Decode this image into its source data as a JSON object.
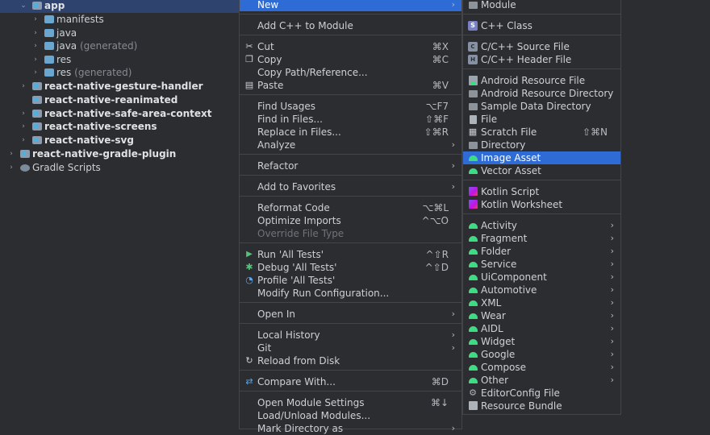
{
  "tree": {
    "items": [
      {
        "label": "app",
        "suffix": "",
        "bold": true,
        "chevron": "⌄",
        "icon": "module",
        "selected": true
      },
      {
        "label": "manifests",
        "suffix": "",
        "bold": false,
        "chevron": "›",
        "icon": "folder"
      },
      {
        "label": "java",
        "suffix": "",
        "bold": false,
        "chevron": "›",
        "icon": "folder"
      },
      {
        "label": "java",
        "suffix": "(generated)",
        "bold": false,
        "chevron": "›",
        "icon": "folder"
      },
      {
        "label": "res",
        "suffix": "",
        "bold": false,
        "chevron": "›",
        "icon": "folder"
      },
      {
        "label": "res",
        "suffix": "(generated)",
        "bold": false,
        "chevron": "›",
        "icon": "folder"
      },
      {
        "label": "react-native-gesture-handler",
        "suffix": "",
        "bold": true,
        "chevron": "›",
        "icon": "module"
      },
      {
        "label": "react-native-reanimated",
        "suffix": "",
        "bold": true,
        "chevron": "",
        "icon": "module"
      },
      {
        "label": "react-native-safe-area-context",
        "suffix": "",
        "bold": true,
        "chevron": "›",
        "icon": "module"
      },
      {
        "label": "react-native-screens",
        "suffix": "",
        "bold": true,
        "chevron": "›",
        "icon": "module"
      },
      {
        "label": "react-native-svg",
        "suffix": "",
        "bold": true,
        "chevron": "›",
        "icon": "module"
      },
      {
        "label": "react-native-gradle-plugin",
        "suffix": "",
        "bold": true,
        "chevron": "›",
        "icon": "module"
      },
      {
        "label": "Gradle Scripts",
        "suffix": "",
        "bold": false,
        "chevron": "›",
        "icon": "gradle"
      }
    ]
  },
  "context_menu": {
    "items": [
      {
        "label": "New",
        "highlighted": true,
        "submenu": true
      },
      {
        "label": "Add C++ to Module"
      },
      {
        "label": "Cut",
        "shortcut": "⌘X",
        "icon": "scissors-icon"
      },
      {
        "label": "Copy",
        "shortcut": "⌘C",
        "icon": "copy-icon"
      },
      {
        "label": "Copy Path/Reference..."
      },
      {
        "label": "Paste",
        "shortcut": "⌘V",
        "icon": "paste-icon"
      },
      {
        "label": "Find Usages",
        "shortcut": "⌥F7"
      },
      {
        "label": "Find in Files...",
        "shortcut": "⇧⌘F"
      },
      {
        "label": "Replace in Files...",
        "shortcut": "⇧⌘R"
      },
      {
        "label": "Analyze",
        "submenu": true
      },
      {
        "label": "Refactor",
        "submenu": true
      },
      {
        "label": "Add to Favorites",
        "submenu": true
      },
      {
        "label": "Reformat Code",
        "shortcut": "⌥⌘L"
      },
      {
        "label": "Optimize Imports",
        "shortcut": "^⌥O"
      },
      {
        "label": "Override File Type",
        "disabled": true
      },
      {
        "label": "Run 'All Tests'",
        "shortcut": "^⇧R",
        "icon": "run-icon"
      },
      {
        "label": "Debug 'All Tests'",
        "shortcut": "^⇧D",
        "icon": "debug-icon"
      },
      {
        "label": "Profile 'All Tests'",
        "icon": "profile-icon"
      },
      {
        "label": "Modify Run Configuration..."
      },
      {
        "label": "Open In",
        "submenu": true
      },
      {
        "label": "Local History",
        "submenu": true
      },
      {
        "label": "Git",
        "submenu": true
      },
      {
        "label": "Reload from Disk",
        "icon": "reload-icon"
      },
      {
        "label": "Compare With...",
        "shortcut": "⌘D",
        "icon": "compare-icon"
      },
      {
        "label": "Open Module Settings",
        "shortcut": "⌘↓"
      },
      {
        "label": "Load/Unload Modules..."
      },
      {
        "label": "Mark Directory as",
        "submenu": true
      }
    ]
  },
  "new_submenu": {
    "items": [
      {
        "label": "Module",
        "icon": "module-icon"
      },
      {
        "label": "C++ Class",
        "icon": "cpp-class-icon"
      },
      {
        "label": "C/C++ Source File",
        "icon": "cpp-source-icon"
      },
      {
        "label": "C/C++ Header File",
        "icon": "cpp-header-icon"
      },
      {
        "label": "Android Resource File",
        "icon": "android-resource-file-icon"
      },
      {
        "label": "Android Resource Directory",
        "icon": "folder-icon"
      },
      {
        "label": "Sample Data Directory",
        "icon": "folder-icon"
      },
      {
        "label": "File",
        "icon": "file-icon"
      },
      {
        "label": "Scratch File",
        "shortcut": "⇧⌘N",
        "icon": "scratch-file-icon"
      },
      {
        "label": "Directory",
        "icon": "folder-icon"
      },
      {
        "label": "Image Asset",
        "highlighted": true,
        "icon": "android-icon"
      },
      {
        "label": "Vector Asset",
        "icon": "android-icon"
      },
      {
        "label": "Kotlin Script",
        "icon": "kotlin-icon"
      },
      {
        "label": "Kotlin Worksheet",
        "icon": "kotlin-icon"
      },
      {
        "label": "Activity",
        "submenu": true,
        "icon": "android-icon"
      },
      {
        "label": "Fragment",
        "submenu": true,
        "icon": "android-icon"
      },
      {
        "label": "Folder",
        "submenu": true,
        "icon": "android-icon"
      },
      {
        "label": "Service",
        "submenu": true,
        "icon": "android-icon"
      },
      {
        "label": "UiComponent",
        "submenu": true,
        "icon": "android-icon"
      },
      {
        "label": "Automotive",
        "submenu": true,
        "icon": "android-icon"
      },
      {
        "label": "XML",
        "submenu": true,
        "icon": "android-icon"
      },
      {
        "label": "Wear",
        "submenu": true,
        "icon": "android-icon"
      },
      {
        "label": "AIDL",
        "submenu": true,
        "icon": "android-icon"
      },
      {
        "label": "Widget",
        "submenu": true,
        "icon": "android-icon"
      },
      {
        "label": "Google",
        "submenu": true,
        "icon": "android-icon"
      },
      {
        "label": "Compose",
        "submenu": true,
        "icon": "android-icon"
      },
      {
        "label": "Other",
        "submenu": true,
        "icon": "android-icon"
      },
      {
        "label": "EditorConfig File",
        "icon": "gear-icon"
      },
      {
        "label": "Resource Bundle",
        "icon": "resource-bundle-icon"
      }
    ]
  },
  "colors": {
    "background": "#2b2d30",
    "highlight": "#2f6bd4",
    "tree_selection": "#2e436e",
    "android_green": "#3ddc84"
  }
}
